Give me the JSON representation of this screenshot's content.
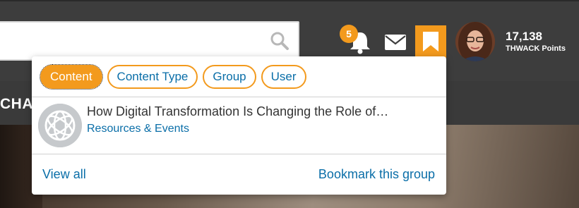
{
  "header": {
    "search": {
      "placeholder": "",
      "value": ""
    },
    "notifications": {
      "count": "5"
    },
    "points": {
      "value": "17,138",
      "label": "THWACK Points"
    },
    "accent_color": "#f39a1d",
    "link_color": "#0a6ea8"
  },
  "nav": {
    "partial_label": "CHA"
  },
  "bookmarks_dropdown": {
    "filters": [
      {
        "label": "Content",
        "active": true
      },
      {
        "label": "Content Type",
        "active": false
      },
      {
        "label": "Group",
        "active": false
      },
      {
        "label": "User",
        "active": false
      }
    ],
    "results": [
      {
        "title": "How Digital Transformation Is Changing the Role of…",
        "subtitle": "Resources & Events",
        "icon": "group-globe-icon"
      }
    ],
    "footer": {
      "view_all": "View all",
      "bookmark_group": "Bookmark this group"
    }
  }
}
